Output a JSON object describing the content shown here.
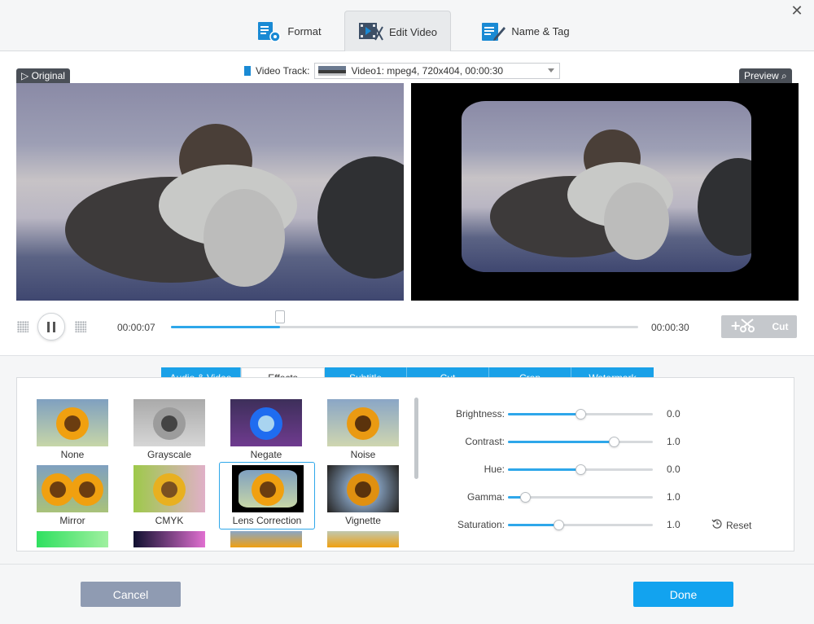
{
  "window": {
    "close_symbol": "✕"
  },
  "tabs": [
    {
      "label": "Format",
      "icon": "format-settings-icon",
      "active": false
    },
    {
      "label": "Edit Video",
      "icon": "edit-video-icon",
      "active": true
    },
    {
      "label": "Name & Tag",
      "icon": "name-tag-icon",
      "active": false
    }
  ],
  "video_track": {
    "label": "Video Track:",
    "value": "Video1: mpeg4, 720x404, 00:00:30"
  },
  "preview": {
    "original_label": "Original",
    "preview_label": "Preview"
  },
  "playback": {
    "current_time": "00:00:07",
    "total_time": "00:00:30",
    "progress": 0.233,
    "cut_label": "Cut"
  },
  "edit_tabs": [
    {
      "label": "Audio & Video",
      "active": false
    },
    {
      "label": "Effects",
      "active": true
    },
    {
      "label": "Subtitle",
      "active": false
    },
    {
      "label": "Cut",
      "active": false
    },
    {
      "label": "Crop",
      "active": false
    },
    {
      "label": "Watermark",
      "active": false
    }
  ],
  "effects": [
    {
      "label": "None",
      "selected": false
    },
    {
      "label": "Grayscale",
      "selected": false
    },
    {
      "label": "Negate",
      "selected": false
    },
    {
      "label": "Noise",
      "selected": false
    },
    {
      "label": "Mirror",
      "selected": false
    },
    {
      "label": "CMYK",
      "selected": false
    },
    {
      "label": "Lens Correction",
      "selected": true
    },
    {
      "label": "Vignette",
      "selected": false
    }
  ],
  "adjustments": [
    {
      "label": "Brightness:",
      "value": "0.0",
      "level": 0.5
    },
    {
      "label": "Contrast:",
      "value": "1.0",
      "level": 0.73
    },
    {
      "label": "Hue:",
      "value": "0.0",
      "level": 0.5
    },
    {
      "label": "Gamma:",
      "value": "1.0",
      "level": 0.12
    },
    {
      "label": "Saturation:",
      "value": "1.0",
      "level": 0.35
    }
  ],
  "reset_label": "Reset",
  "footer": {
    "cancel_label": "Cancel",
    "done_label": "Done"
  },
  "colors": {
    "accent": "#1aa1e8",
    "done_button": "#12a3ef",
    "cancel_button": "#8f9bb2",
    "tag_bg": "#4a4f57"
  }
}
